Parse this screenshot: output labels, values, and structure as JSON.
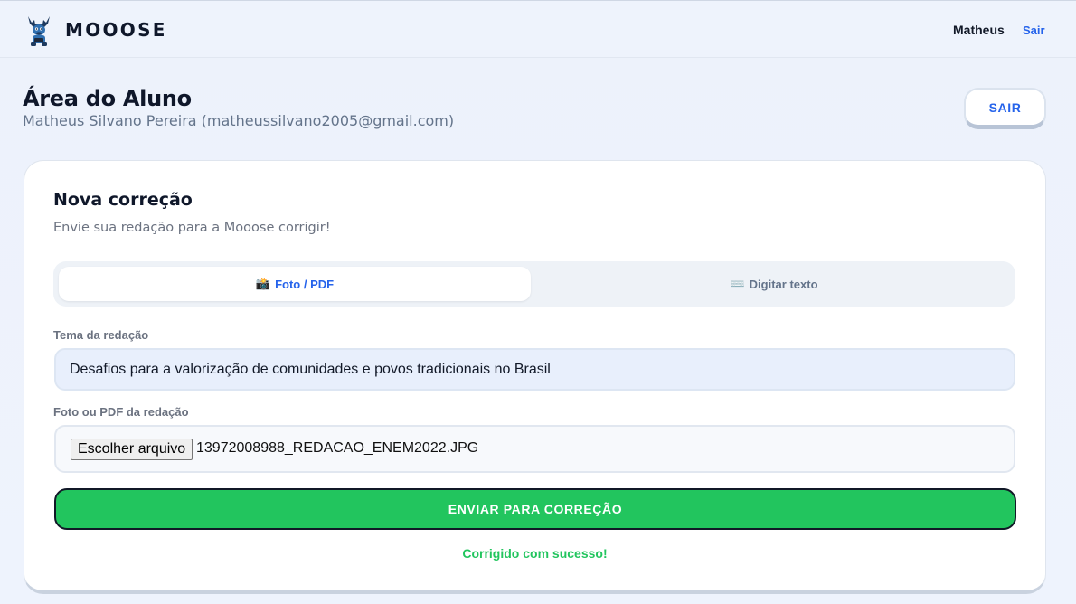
{
  "header": {
    "brand": "MOOOSE",
    "user_name": "Matheus",
    "logout_link": "Sair"
  },
  "page": {
    "title": "Área do Aluno",
    "subtitle": "Matheus Silvano Pereira (matheussilvano2005@gmail.com)",
    "logout_button": "SAIR"
  },
  "card": {
    "title": "Nova correção",
    "subtitle": "Envie sua redação para a Mooose corrigir!",
    "tabs": [
      {
        "icon": "📸",
        "icon_name": "camera-icon",
        "label": "Foto / PDF",
        "active": true
      },
      {
        "icon": "⌨️",
        "icon_name": "keyboard-icon",
        "label": "Digitar texto",
        "active": false
      }
    ],
    "theme_label": "Tema da redação",
    "theme_value": "Desafios para a valorização de comunidades e povos tradicionais no Brasil",
    "file_label": "Foto ou PDF da redação",
    "file_button": "Escolher arquivo",
    "file_name": "13972008988_REDACAO_ENEM2022.JPG",
    "submit_button": "ENVIAR PARA CORREÇÃO",
    "status_message": "Corrigido com sucesso!"
  },
  "colors": {
    "accent": "#2563eb",
    "success": "#22c55e",
    "text_dark": "#0f172a",
    "text_muted": "#64748b"
  }
}
